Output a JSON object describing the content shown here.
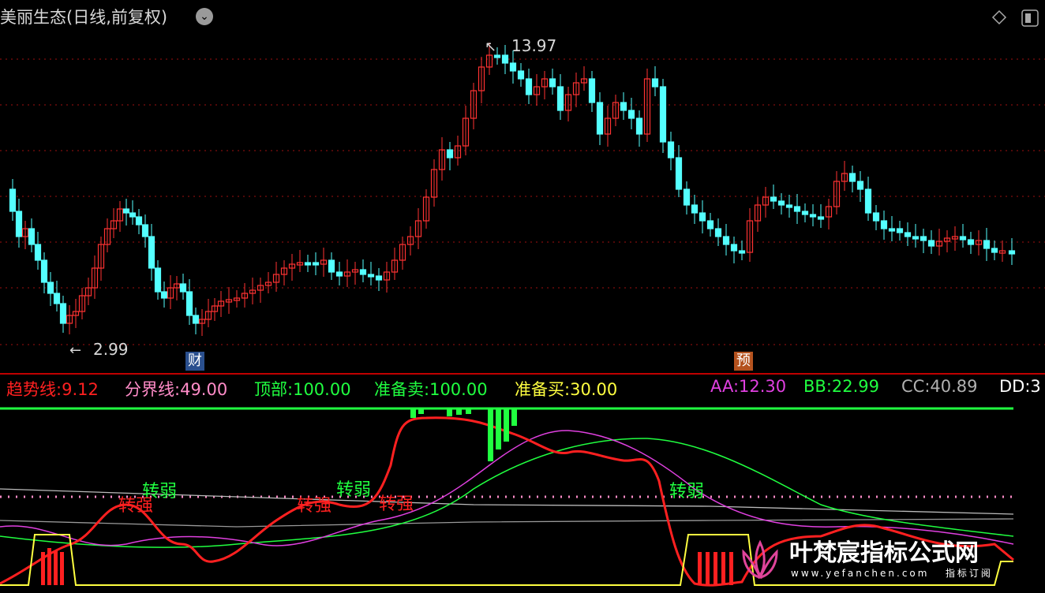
{
  "header": {
    "title": "美丽生态(日线,前复权)",
    "dropdown_icon": "chevron-down-icon",
    "right_icons": [
      "diamond-icon",
      "window-toggle-icon"
    ]
  },
  "chart_data": [
    {
      "type": "candlestick",
      "title": "美丽生态(日线,前复权)",
      "up_color": "#ff3232",
      "down_color": "#54ffff",
      "annotations": {
        "high_label": "13.97",
        "low_label": "2.99"
      },
      "event_markers": [
        {
          "label": "财",
          "color": "#3a5f9e"
        },
        {
          "label": "预",
          "color": "#b4521e"
        }
      ],
      "approx_price_range": [
        2.99,
        13.97
      ],
      "grid": "dotted horizontal"
    },
    {
      "type": "line",
      "indicator_lines": [
        {
          "name": "趋势线",
          "value": "9.12",
          "color": "#ff2020"
        },
        {
          "name": "分界线",
          "value": "49.00",
          "color": "#ff8cc8"
        },
        {
          "name": "顶部",
          "value": "100.00",
          "color": "#20ff40"
        },
        {
          "name": "准备卖",
          "value": "100.00",
          "color": "#20ff40"
        },
        {
          "name": "准备买",
          "value": "30.00",
          "color": "#ffff40"
        },
        {
          "name": "AA",
          "value": "12.30",
          "color": "#e040e0"
        },
        {
          "name": "BB",
          "value": "22.99",
          "color": "#20ff40"
        },
        {
          "name": "CC",
          "value": "40.89",
          "color": "#b0b0b0"
        },
        {
          "name": "DD",
          "value": "3",
          "color": "#ffffff"
        }
      ],
      "signal_labels": [
        "转弱",
        "转强"
      ],
      "top_level": 100,
      "divider_level": 49,
      "buy_level": 30
    }
  ],
  "legend_items": [
    {
      "label": "趋势线:",
      "value": "9.12",
      "color": "#ff2020"
    },
    {
      "label": "分界线:",
      "value": "49.00",
      "color": "#ff8cc8"
    },
    {
      "label": "顶部:",
      "value": "100.00",
      "color": "#20ff40"
    },
    {
      "label": "准备卖:",
      "value": "100.00",
      "color": "#20ff40"
    },
    {
      "label": "准备买:",
      "value": "30.00",
      "color": "#ffff40"
    },
    {
      "label": "AA:",
      "value": "12.30",
      "color": "#e040e0"
    },
    {
      "label": "BB:",
      "value": "22.99",
      "color": "#20ff40"
    },
    {
      "label": "CC:",
      "value": "40.89",
      "color": "#b0b0b0"
    },
    {
      "label": "DD:",
      "value": "3",
      "color": "#ffffff"
    }
  ],
  "watermark": {
    "title": "叶梵宸指标公式网",
    "url": "www.yefanchen.com",
    "tag": "指标订阅"
  }
}
